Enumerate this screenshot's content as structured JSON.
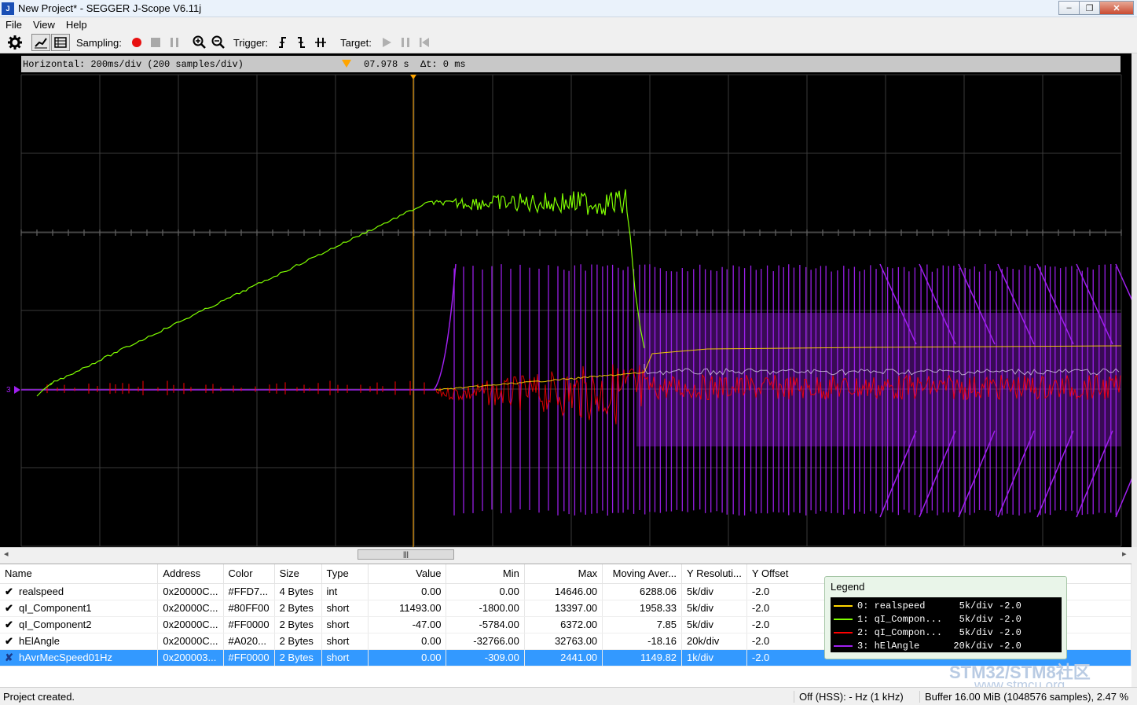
{
  "window": {
    "title": "New Project* - SEGGER J-Scope V6.11j",
    "icon_text": "J"
  },
  "menu": [
    "File",
    "View",
    "Help"
  ],
  "toolbar": {
    "sampling_label": "Sampling:",
    "trigger_label": "Trigger:",
    "target_label": "Target:",
    "colors": {
      "record": "#e81010"
    }
  },
  "scope": {
    "horizontal_info": "Horizontal: 200ms/div (200 samples/div)",
    "cursor_time": "07.978 s",
    "delta_t": "Δt: 0 ms",
    "channel_marker": "3",
    "colors": {
      "green": "#80ff00",
      "red": "#ff0000",
      "purple": "#a020f0",
      "yellow": "#ffd700",
      "grid": "#3a3a3a",
      "cursor": "#ffa500"
    }
  },
  "table": {
    "headers": [
      "Name",
      "Address",
      "Color",
      "Size",
      "Type",
      "Value",
      "Min",
      "Max",
      "Moving Aver...",
      "Y Resoluti...",
      "Y Offset"
    ],
    "rows": [
      {
        "checked": "✔",
        "name": "realspeed",
        "address": "0x20000C...",
        "color": "#FFD7...",
        "size": "4 Bytes",
        "type": "int",
        "value": "0.00",
        "min": "0.00",
        "max": "14646.00",
        "avg": "6288.06",
        "yres": "5k/div",
        "yoff": "-2.0"
      },
      {
        "checked": "✔",
        "name": "qI_Component1",
        "address": "0x20000C...",
        "color": "#80FF00",
        "size": "2 Bytes",
        "type": "short",
        "value": "11493.00",
        "min": "-1800.00",
        "max": "13397.00",
        "avg": "1958.33",
        "yres": "5k/div",
        "yoff": "-2.0"
      },
      {
        "checked": "✔",
        "name": "qI_Component2",
        "address": "0x20000C...",
        "color": "#FF0000",
        "size": "2 Bytes",
        "type": "short",
        "value": "-47.00",
        "min": "-5784.00",
        "max": "6372.00",
        "avg": "7.85",
        "yres": "5k/div",
        "yoff": "-2.0"
      },
      {
        "checked": "✔",
        "name": "hElAngle",
        "address": "0x20000C...",
        "color": "#A020...",
        "size": "2 Bytes",
        "type": "short",
        "value": "0.00",
        "min": "-32766.00",
        "max": "32763.00",
        "avg": "-18.16",
        "yres": "20k/div",
        "yoff": "-2.0"
      },
      {
        "checked": "✘",
        "name": "hAvrMecSpeed01Hz",
        "address": "0x200003...",
        "color": "#FF0000",
        "size": "2 Bytes",
        "type": "short",
        "value": "0.00",
        "min": "-309.00",
        "max": "2441.00",
        "avg": "1149.82",
        "yres": "1k/div",
        "yoff": "-2.0"
      }
    ]
  },
  "legend": {
    "title": "Legend",
    "rows": [
      {
        "text": "0: realspeed      5k/div -2.0",
        "color": "#FFD700"
      },
      {
        "text": "1: qI_Compon...   5k/div -2.0",
        "color": "#80FF00"
      },
      {
        "text": "2: qI_Compon...   5k/div -2.0",
        "color": "#FF0000"
      },
      {
        "text": "3: hElAngle      20k/div -2.0",
        "color": "#A020F0"
      }
    ]
  },
  "status": {
    "left": "Project created.",
    "clock": "Off (HSS): - Hz (1 kHz)",
    "buffer": "Buffer 16.00 MiB (1048576 samples), 2.47 %"
  },
  "watermark": {
    "line1": "STM32/STM8社区",
    "line2": "www.stmcu.org"
  }
}
